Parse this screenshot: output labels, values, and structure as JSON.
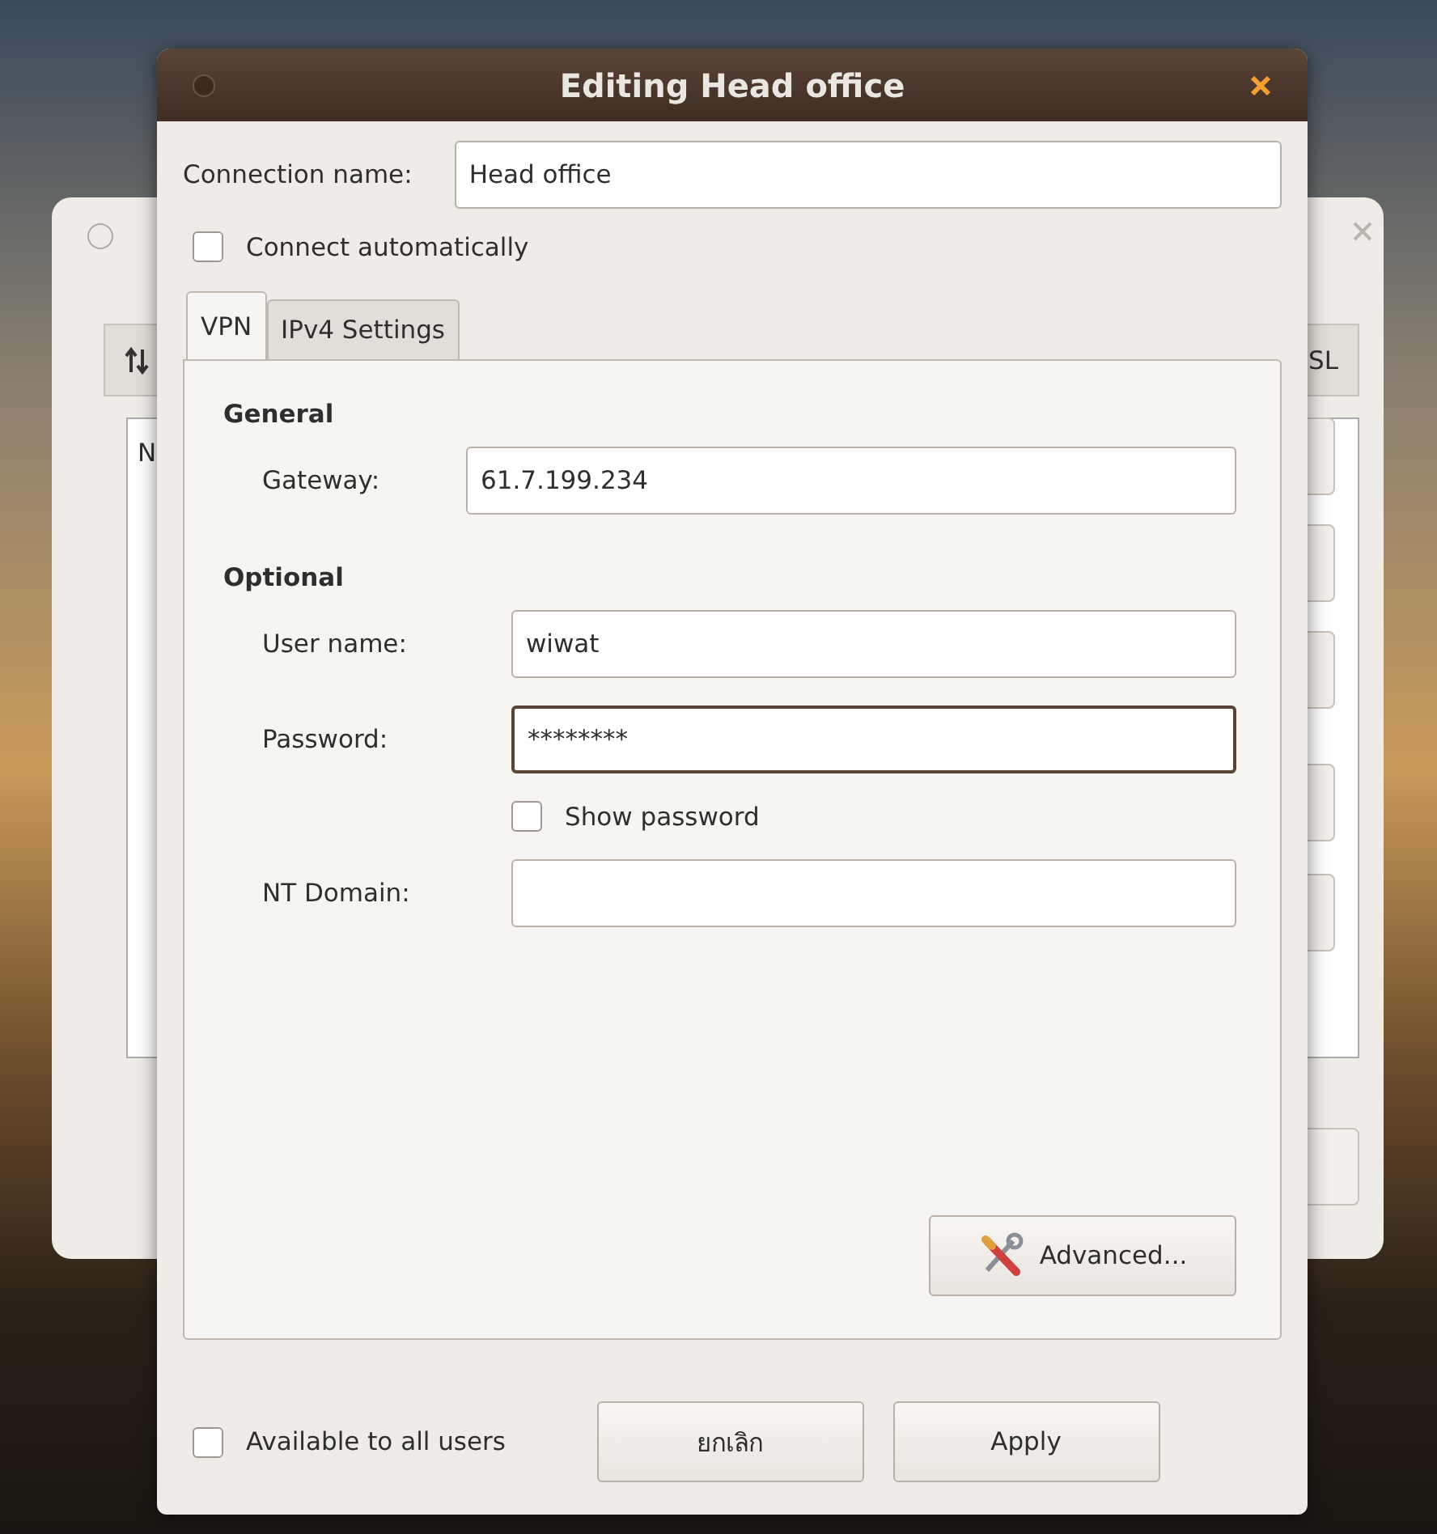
{
  "back_window": {
    "list_header": "N",
    "tab": "SL"
  },
  "dialog": {
    "title": "Editing Head office",
    "connection_name": {
      "label": "Connection name:",
      "value": "Head office"
    },
    "connect_automatically": {
      "label": "Connect automatically",
      "checked": false
    },
    "tabs": [
      {
        "label": "VPN",
        "selected": true
      },
      {
        "label": "IPv4 Settings",
        "selected": false
      }
    ],
    "sections": [
      {
        "heading": "General",
        "rows": [
          {
            "kind": "field",
            "label": "Gateway:",
            "value": "61.7.199.234",
            "focused": false
          }
        ]
      },
      {
        "heading": "Optional",
        "rows": [
          {
            "kind": "field",
            "label": "User name:",
            "value": "wiwat",
            "focused": false
          },
          {
            "kind": "field",
            "label": "Password:",
            "value": "********",
            "focused": true
          },
          {
            "kind": "checkbox",
            "label": "Show password",
            "checked": false
          },
          {
            "kind": "field",
            "label": "NT Domain:",
            "value": "",
            "focused": false
          }
        ]
      }
    ],
    "advanced_button": "Advanced...",
    "available_to_all_users": {
      "label": "Available to all users",
      "checked": false
    },
    "buttons": [
      "ยกเลิก",
      "Apply"
    ]
  }
}
